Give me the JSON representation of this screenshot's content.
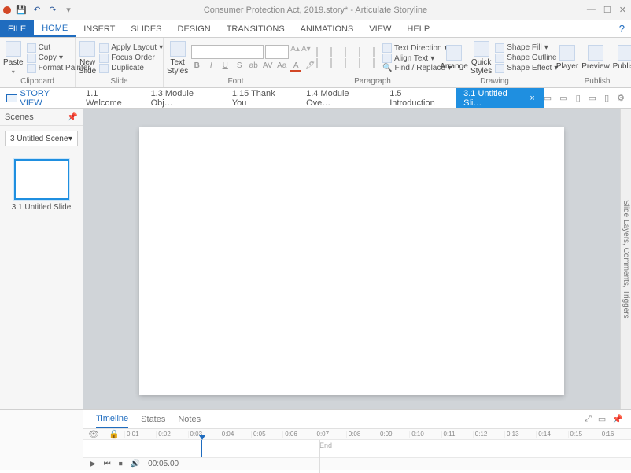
{
  "app": {
    "title": "Consumer Protection Act, 2019.story* - Articulate Storyline"
  },
  "menu_tabs": [
    "FILE",
    "HOME",
    "INSERT",
    "SLIDES",
    "DESIGN",
    "TRANSITIONS",
    "ANIMATIONS",
    "VIEW",
    "HELP"
  ],
  "active_menu": "HOME",
  "ribbon": {
    "clipboard": {
      "paste": "Paste",
      "cut": "Cut",
      "copy": "Copy",
      "format_painter": "Format Painter",
      "label": "Clipboard"
    },
    "slide": {
      "new_slide": "New\nSlide",
      "apply_layout": "Apply Layout",
      "focus_order": "Focus Order",
      "duplicate": "Duplicate",
      "label": "Slide"
    },
    "font": {
      "text_styles": "Text\nStyles",
      "label": "Font"
    },
    "paragraph": {
      "text_direction": "Text Direction",
      "align_text": "Align Text",
      "find_replace": "Find / Replace",
      "label": "Paragraph"
    },
    "drawing": {
      "arrange": "Arrange",
      "quick_styles": "Quick\nStyles",
      "shape_fill": "Shape Fill",
      "shape_outline": "Shape Outline",
      "shape_effect": "Shape Effect",
      "label": "Drawing"
    },
    "publish": {
      "player": "Player",
      "preview": "Preview",
      "publish": "Publish",
      "label": "Publish"
    }
  },
  "secondary": {
    "story_view": "STORY VIEW",
    "tabs": [
      "1.1 Welcome",
      "1.3 Module Obj…",
      "1.15 Thank You",
      "1.4 Module Ove…",
      "1.5 Introduction",
      "3.1 Untitled Sli…"
    ],
    "active_tab": "3.1 Untitled Sli…"
  },
  "scenes": {
    "title": "Scenes",
    "selected": "3 Untitled Scene",
    "thumb_label": "3.1 Untitled Slide"
  },
  "sidepanel_label": "Slide Layers, Comments, Triggers",
  "timeline": {
    "tabs": [
      "Timeline",
      "States",
      "Notes"
    ],
    "active": "Timeline",
    "ticks": [
      "0:01",
      "0:02",
      "0:03",
      "0:04",
      "0:05",
      "0:06",
      "0:07",
      "0:08",
      "0:09",
      "0:10",
      "0:11",
      "0:12",
      "0:13",
      "0:14",
      "0:15",
      "0:16"
    ],
    "end_label": "End",
    "total": "00:05.00"
  }
}
